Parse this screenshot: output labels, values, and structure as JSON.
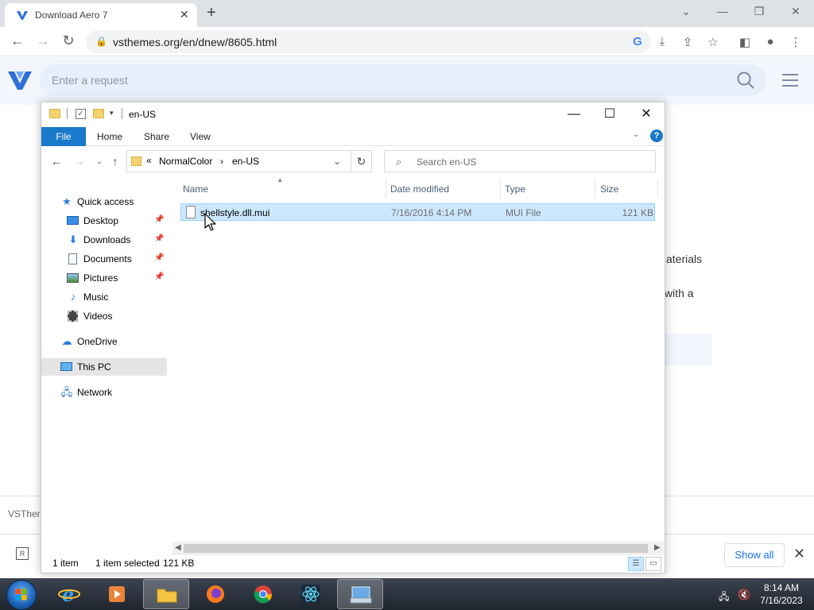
{
  "browser": {
    "tab_title": "Download Aero 7",
    "tab_close": "✕",
    "new_tab": "+",
    "url": "vsthemes.org/en/dnew/8605.html"
  },
  "website": {
    "search_placeholder": "Enter a request",
    "partial_text_1": "aterials",
    "partial_text_2": "with a",
    "footer_text": "VSTher",
    "show_all": "Show all",
    "download_icon": "R"
  },
  "explorer": {
    "window_title": "en-US",
    "ribbon": {
      "file": "File",
      "home": "Home",
      "share": "Share",
      "view": "View",
      "help": "?"
    },
    "address": {
      "overflow": "«",
      "crumbs": [
        "NormalColor",
        "en-US"
      ],
      "separator": "›"
    },
    "search_placeholder": "Search en-US",
    "nav_pane": {
      "quick_access": "Quick access",
      "desktop": "Desktop",
      "downloads": "Downloads",
      "documents": "Documents",
      "pictures": "Pictures",
      "music": "Music",
      "videos": "Videos",
      "onedrive": "OneDrive",
      "this_pc": "This PC",
      "network": "Network"
    },
    "columns": {
      "name": "Name",
      "date_modified": "Date modified",
      "type": "Type",
      "size": "Size"
    },
    "files": [
      {
        "name": "shellstyle.dll.mui",
        "date_modified": "7/16/2016 4:14 PM",
        "type": "MUI File",
        "size": "121 KB"
      }
    ],
    "status": {
      "item_count": "1 item",
      "selected": "1 item selected",
      "selected_size": "121 KB"
    }
  },
  "taskbar": {
    "time": "8:14 AM",
    "date": "7/16/2023"
  },
  "colors": {
    "ribbon_file_blue": "#1979ca",
    "selection_fill": "#cce8ff",
    "selection_border": "#99d1ff",
    "site_header_bg": "#f3f7fd"
  }
}
